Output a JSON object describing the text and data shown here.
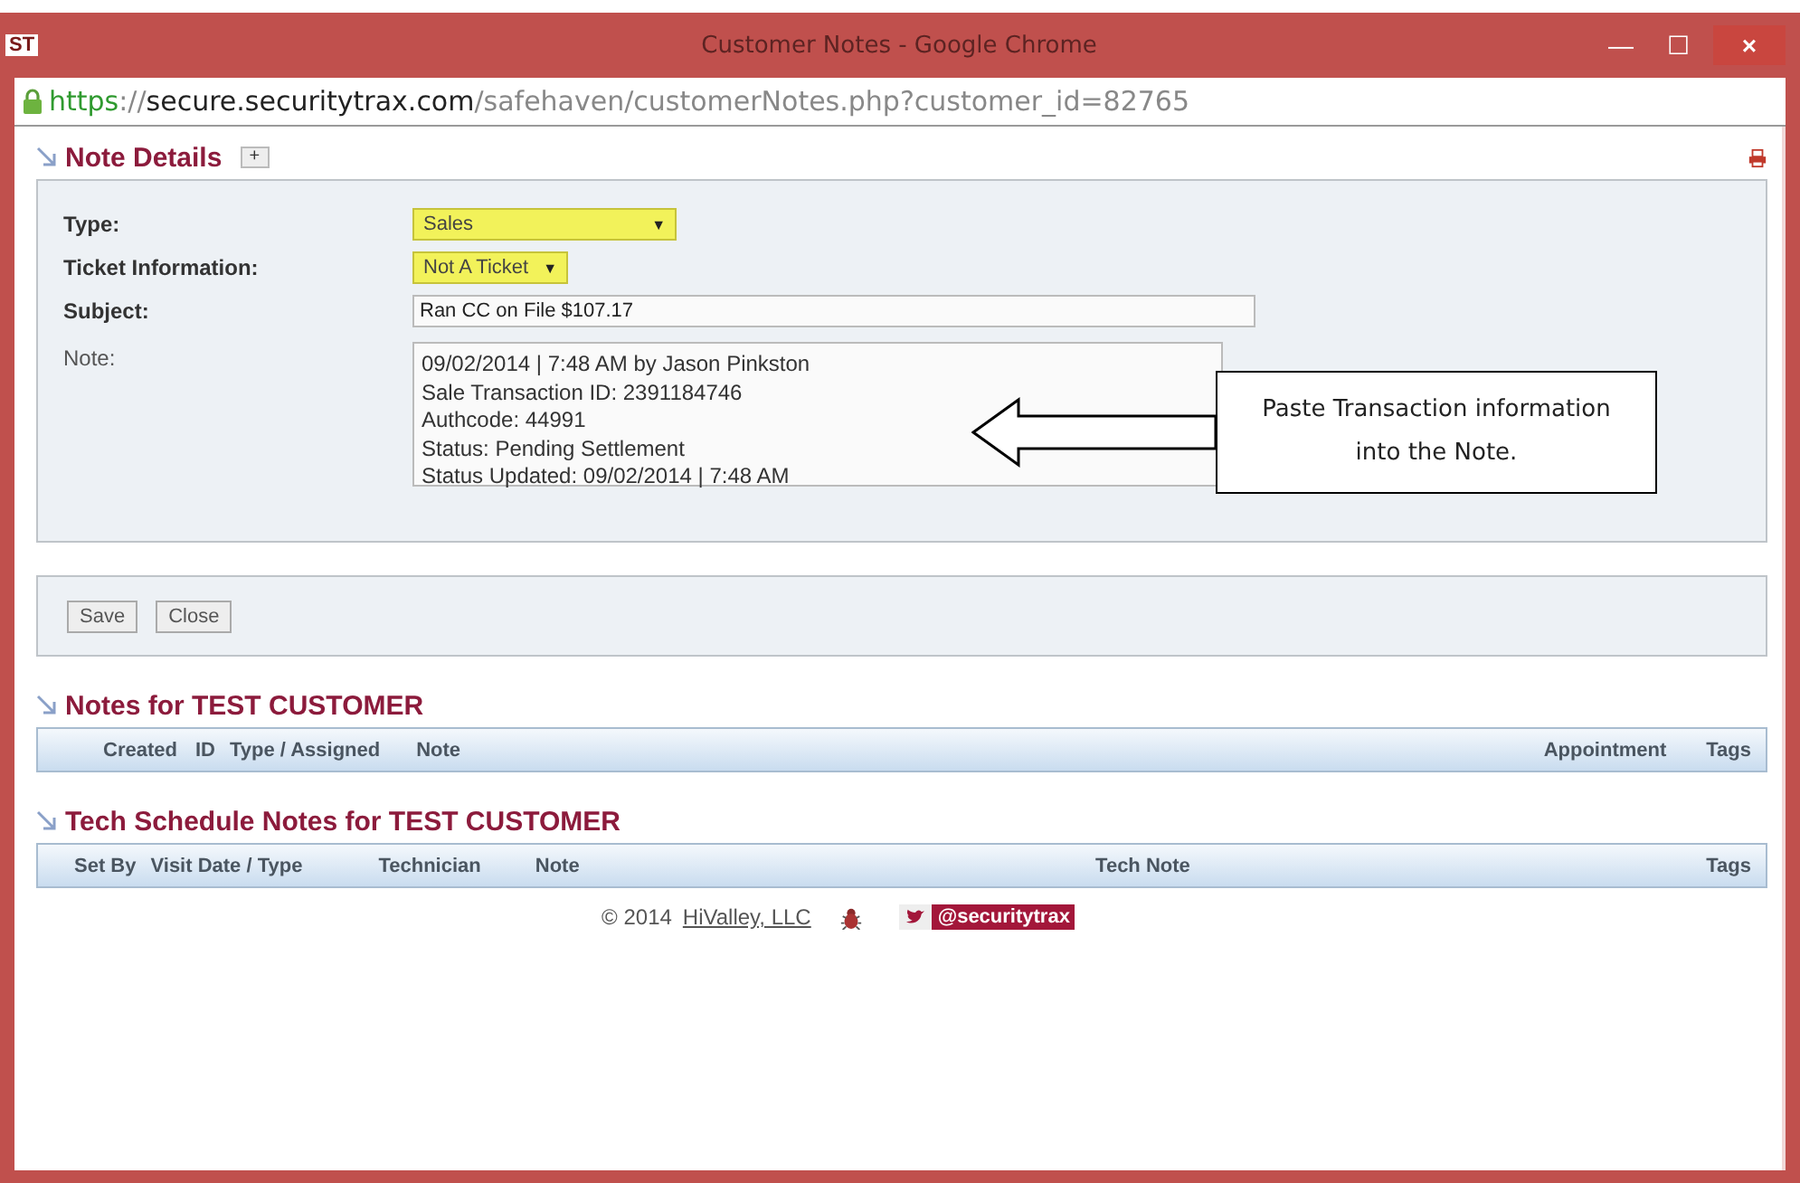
{
  "window": {
    "logo": "ST",
    "title": "Customer Notes - Google Chrome",
    "controls": [
      "—",
      "☐",
      "×"
    ]
  },
  "address": {
    "scheme": "https",
    "separator": "://",
    "host": "secure.securitytrax.com",
    "path": "/safehaven/customerNotes.php?customer_id=82765"
  },
  "note_details": {
    "title": "Note Details",
    "expand": "+",
    "fields": [
      {
        "kind": "select",
        "label": "Type:",
        "value": "Sales",
        "caret": "▼"
      },
      {
        "kind": "select",
        "label": "Ticket Information:",
        "value": "Not A Ticket",
        "caret": "▼"
      },
      {
        "kind": "text",
        "label": "Subject:",
        "value": "Ran CC on File $107.17"
      },
      {
        "kind": "textarea",
        "label": "Note:",
        "lines": [
          "09/02/2014 | 7:48 AM by Jason Pinkston",
          "Sale Transaction ID: 2391184746",
          "Authcode: 44991",
          "Status: Pending Settlement",
          "Status Updated: 09/02/2014 | 7:48 AM"
        ]
      }
    ],
    "callout": "Paste Transaction information into the Note."
  },
  "buttons": [
    "Save",
    "Close"
  ],
  "tables": [
    {
      "title": "Notes for TEST CUSTOMER",
      "columns": [
        "Created",
        "ID",
        "Type / Assigned",
        "Note",
        "Appointment",
        "Tags"
      ]
    },
    {
      "title": "Tech Schedule Notes for TEST CUSTOMER",
      "columns": [
        "Set By",
        "Visit Date / Type",
        "Technician",
        "Note",
        "Tech Note",
        "Tags"
      ]
    }
  ],
  "footer": {
    "copyright": "© 2014",
    "company": "HiValley, LLC",
    "twitter": "@securitytrax"
  }
}
